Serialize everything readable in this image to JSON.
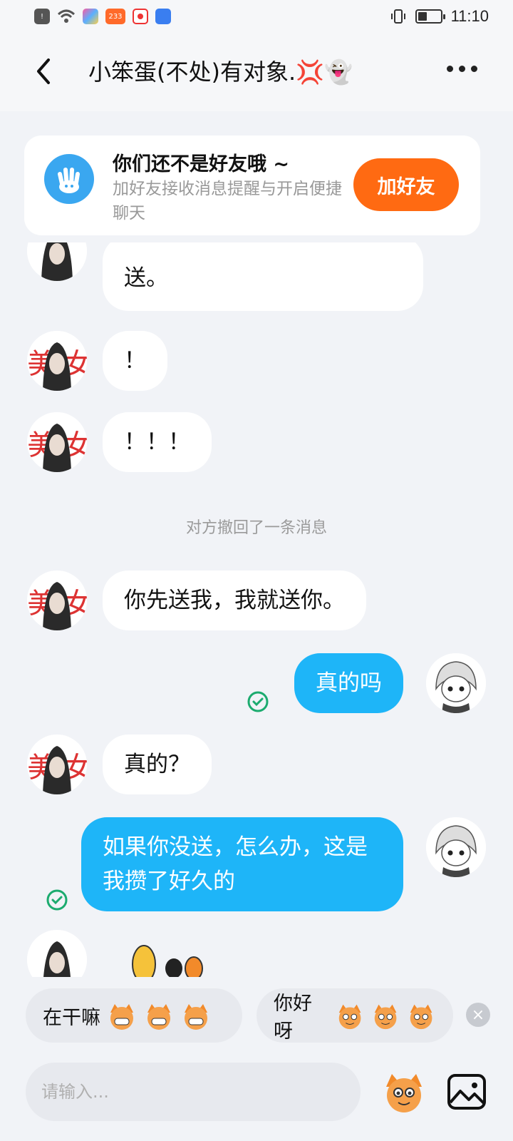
{
  "status_bar": {
    "time": "11:10",
    "notification_badge": "233",
    "battery_level_percent": 40
  },
  "header": {
    "title": "小笨蛋(不处)有对象.💢👻"
  },
  "friend_banner": {
    "title": "你们还不是好友哦 ~",
    "subtitle": "加好友接收消息提醒与开启便捷聊天",
    "button": "加好友"
  },
  "messages": [
    {
      "side": "in",
      "text": "送。"
    },
    {
      "side": "in",
      "text": "！"
    },
    {
      "side": "in",
      "text": "！！！"
    },
    {
      "side": "system",
      "text": "对方撤回了一条消息"
    },
    {
      "side": "in",
      "text": "你先送我，我就送你。"
    },
    {
      "side": "out",
      "text": "真的吗"
    },
    {
      "side": "in",
      "text": "真的？"
    },
    {
      "side": "out",
      "text": "如果你没送，怎么办，这是我攒了好久的"
    }
  ],
  "quick_replies": [
    {
      "text": "在干嘛"
    },
    {
      "text": "你好呀"
    }
  ],
  "input": {
    "placeholder": "请输入..."
  },
  "colors": {
    "accent_blue": "#1eb5f8",
    "add_friend_orange": "#ff6a12",
    "read_check_green": "#1cab6f"
  }
}
